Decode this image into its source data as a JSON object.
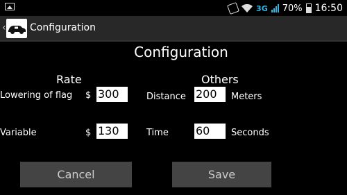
{
  "status_bar": {
    "network": "3G",
    "battery_percent": "70%",
    "time": "16:50"
  },
  "action_bar": {
    "title": "Configuration"
  },
  "page_title": "Configuration",
  "rate": {
    "heading": "Rate",
    "lowering_label": "Lowering of flag",
    "lowering_currency": "$",
    "lowering_value": "300",
    "variable_label": "Variable",
    "variable_currency": "$",
    "variable_value": "130"
  },
  "others": {
    "heading": "Others",
    "distance_label": "Distance",
    "distance_value": "200",
    "distance_unit": "Meters",
    "time_label": "Time",
    "time_value": "60",
    "time_unit": "Seconds"
  },
  "buttons": {
    "cancel": "Cancel",
    "save": "Save"
  }
}
